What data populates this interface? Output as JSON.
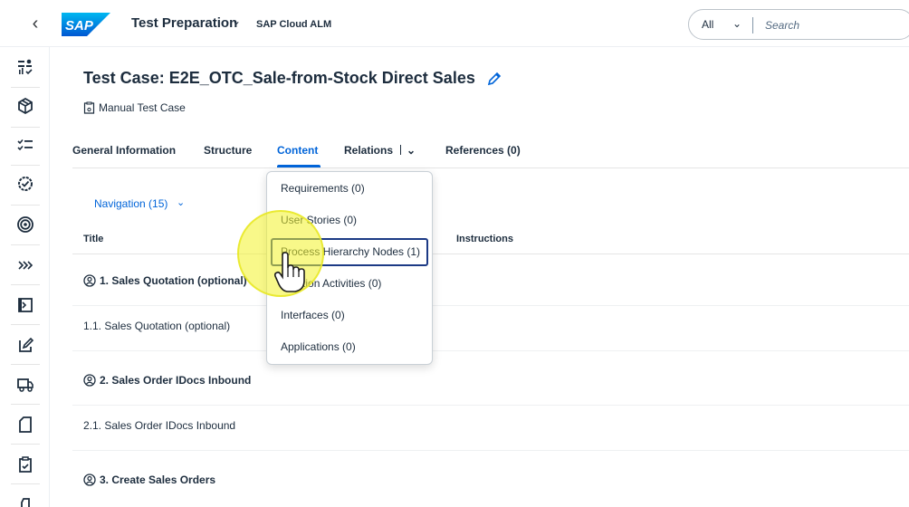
{
  "shell": {
    "logo_text": "SAP",
    "app_title": "Test Preparation",
    "product_name": "SAP Cloud ALM",
    "search_scope": "All",
    "search_placeholder": "Search"
  },
  "sidenav": {
    "items": [
      {
        "name": "overview-icon"
      },
      {
        "name": "cube-icon"
      },
      {
        "name": "checklist-icon"
      },
      {
        "name": "gear-check-icon"
      },
      {
        "name": "target-icon"
      },
      {
        "name": "chevrons-right-icon"
      },
      {
        "name": "document-code-icon"
      },
      {
        "name": "edit-box-icon"
      },
      {
        "name": "truck-icon"
      },
      {
        "name": "page-icon"
      },
      {
        "name": "clipboard-check-icon"
      }
    ]
  },
  "header": {
    "title": "Test Case: E2E_OTC_Sale-from-Stock Direct Sales",
    "subtype": "Manual Test Case"
  },
  "tabs": [
    {
      "label": "General Information"
    },
    {
      "label": "Structure"
    },
    {
      "label": "Content"
    },
    {
      "label": "Relations"
    },
    {
      "label": "References (0)"
    }
  ],
  "content": {
    "navigation_label": "Navigation (15)",
    "columns": {
      "title": "Title",
      "instructions": "Instructions"
    },
    "rows": [
      {
        "text": "1. Sales Quotation (optional)",
        "bold": true
      },
      {
        "text": "1.1. Sales Quotation (optional)",
        "bold": false
      },
      {
        "text": "2. Sales Order IDocs Inbound",
        "bold": true
      },
      {
        "text": "2.1. Sales Order IDocs Inbound",
        "bold": false
      },
      {
        "text": "3. Create Sales Orders",
        "bold": true
      }
    ]
  },
  "relations_menu": {
    "items": [
      {
        "label": "Requirements (0)"
      },
      {
        "label": "User Stories (0)"
      },
      {
        "label": "Process Hierarchy Nodes (1)",
        "focused": true
      },
      {
        "label": "Solution Activities (0)"
      },
      {
        "label": "Interfaces (0)"
      },
      {
        "label": "Applications (0)"
      }
    ]
  },
  "colors": {
    "accent": "#0064d9",
    "text": "#1d2d3e",
    "focus_border": "#1c3a85",
    "click_highlight": "#f2f228"
  }
}
